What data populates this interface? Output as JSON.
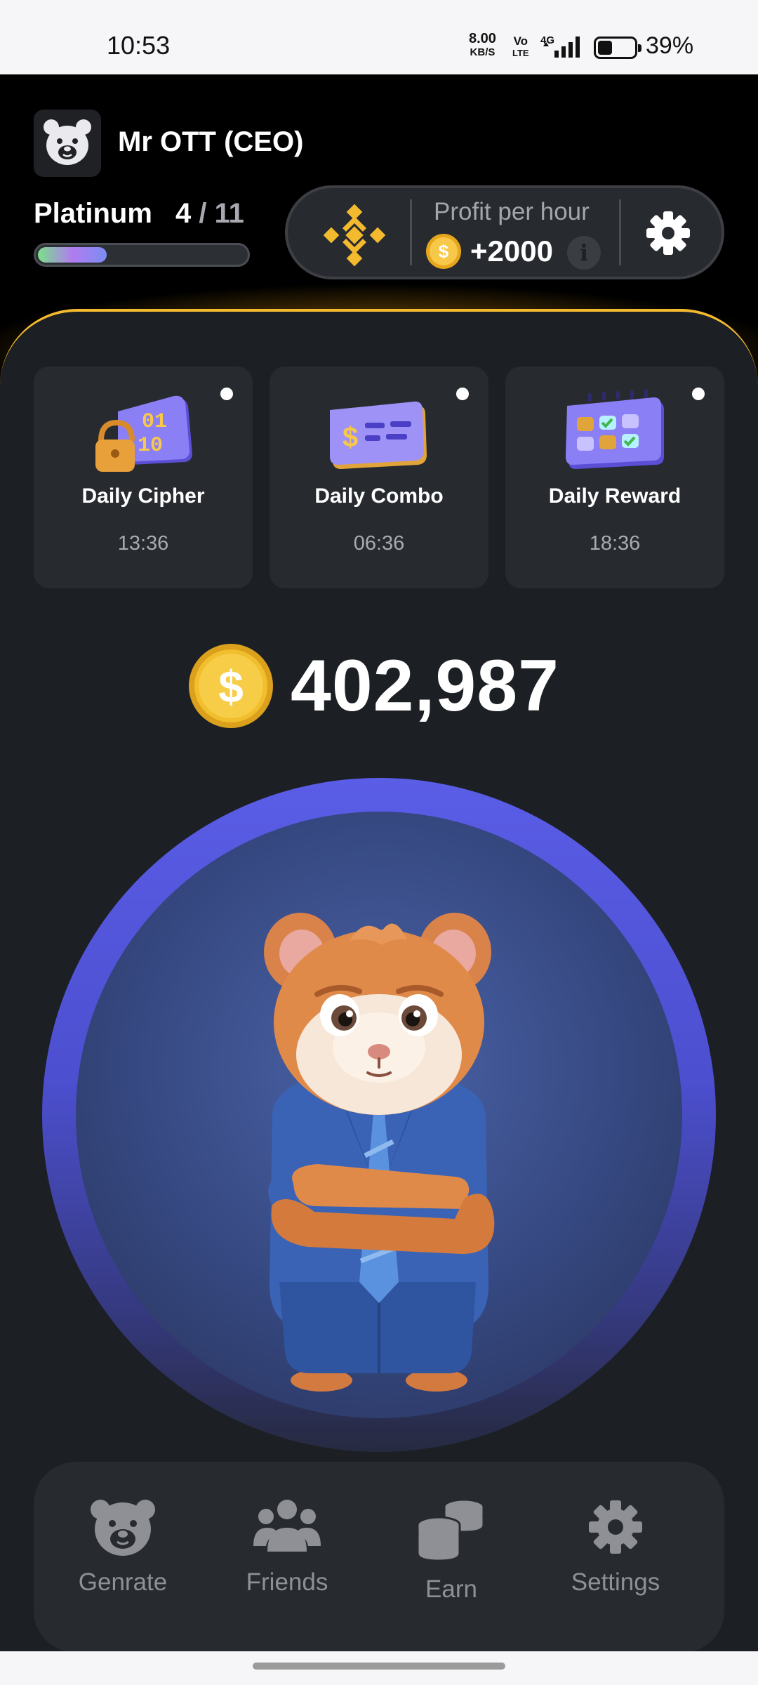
{
  "status_bar": {
    "time": "10:53",
    "speed_value": "8.00",
    "speed_unit": "KB/S",
    "volte_top": "Vo",
    "volte_bottom": "LTE",
    "network": "4G",
    "battery_percent": "39%",
    "battery_level": 0.39
  },
  "header": {
    "user_name": "Mr OTT (CEO)",
    "avatar_icon": "bear-icon",
    "level_name": "Platinum",
    "level_current": "4",
    "level_separator": " / ",
    "level_total": "11",
    "level_progress": 0.33,
    "exchange_icon": "binance-icon",
    "profit_label": "Profit per hour",
    "profit_value": "+2000",
    "info_glyph": "i",
    "settings_icon": "gear-icon"
  },
  "daily": [
    {
      "title": "Daily Cipher",
      "timer": "13:36",
      "icon": "cipher-lock-icon"
    },
    {
      "title": "Daily Combo",
      "timer": "06:36",
      "icon": "combo-card-icon"
    },
    {
      "title": "Daily Reward",
      "timer": "18:36",
      "icon": "calendar-reward-icon"
    }
  ],
  "balance": {
    "value": "402,987",
    "icon": "coin-icon"
  },
  "tap_target": {
    "character": "hamster-ceo"
  },
  "nav": [
    {
      "label": "Genrate",
      "icon": "bear-icon"
    },
    {
      "label": "Friends",
      "icon": "friends-icon"
    },
    {
      "label": "Earn",
      "icon": "coins-stack-icon"
    },
    {
      "label": "Settings",
      "icon": "gear-icon"
    }
  ],
  "colors": {
    "accent_gold": "#f3ba2f",
    "panel": "#1c1f24",
    "card": "#272a2f",
    "tap_ring": "#5a5de6"
  }
}
